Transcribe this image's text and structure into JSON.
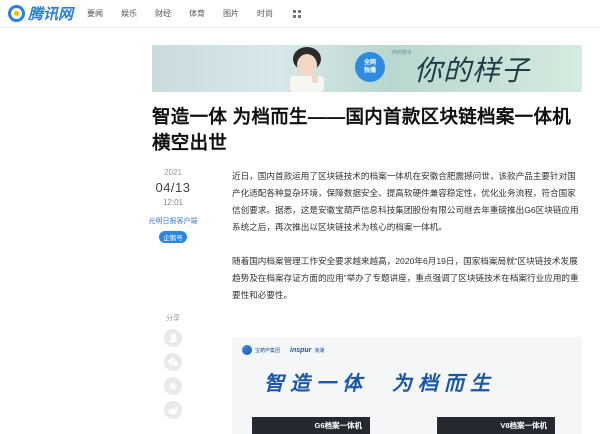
{
  "brand": {
    "logo_text": "腾讯网",
    "accent": "#2a7fe0"
  },
  "nav": {
    "items": [
      "要闻",
      "娱乐",
      "财经",
      "体育",
      "图片",
      "时尚"
    ]
  },
  "banner": {
    "badge_text": "全网\n独播",
    "slogan": "你的样子",
    "tag": "你的样子"
  },
  "article": {
    "title": "智造一体 为档而生——国内首款区块链档案一体机横空出世",
    "date": {
      "year": "2021",
      "month_day": "04/13",
      "time": "12:01"
    },
    "source": "光明日报客户端",
    "source_badge": "企鹅号",
    "share_label": "分享",
    "paragraphs": [
      "近日，国内首款运用了区块链技术的档案一体机在安徽合肥震撼问世，该款产品主要针对国产化适配各种复杂环境，保障数据安全、提高软硬件兼容稳定性，优化业务流程，符合国家信创要求。据悉，这是安徽宝葫芦信息科技集团股份有限公司继去年重磅推出G6区块链应用系统之后，再次推出以区块链技术为核心的档案一体机。",
      "随着国内档案管理工作安全要求越来越高，2020年6月19日，国家档案局就“区块链技术发展趋势及在档案存证方面的应用”举办了专题讲座，重点强调了区块链技术在档案行业应用的重要性和必要性。"
    ]
  },
  "figure": {
    "brand": "宝葫芦集团",
    "inspur": "inspur",
    "inspur_cn": "浪潮",
    "slogan_left": "智造一体",
    "slogan_right": "为档而生",
    "product_left": "G6档案一体机",
    "product_right": "V8档案一体机"
  }
}
